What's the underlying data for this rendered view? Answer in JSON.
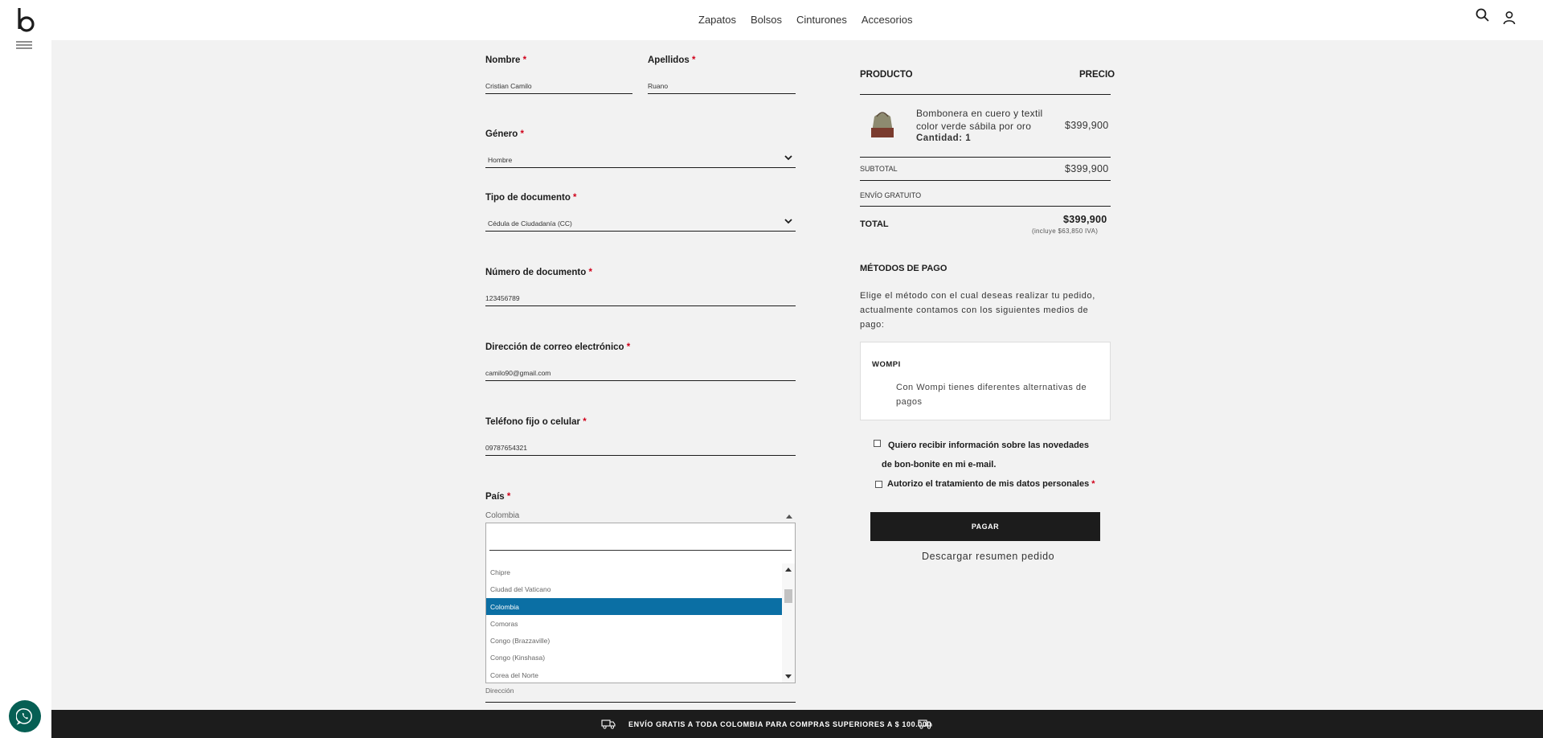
{
  "header": {
    "nav": [
      "Zapatos",
      "Bolsos",
      "Cinturones",
      "Accesorios"
    ]
  },
  "form": {
    "nombre": {
      "label": "Nombre",
      "value": "Cristian Camilo"
    },
    "apellidos": {
      "label": "Apellidos",
      "value": "Ruano"
    },
    "genero": {
      "label": "Género",
      "value": "Hombre"
    },
    "tipo_documento": {
      "label": "Tipo de documento",
      "value": "Cédula de Ciudadanía (CC)"
    },
    "numero_documento": {
      "label": "Número de documento",
      "value": "123456789"
    },
    "email": {
      "label": "Dirección de correo electrónico",
      "value": "camilo90@gmail.com"
    },
    "telefono": {
      "label": "Teléfono fijo o celular",
      "value": "09787654321"
    },
    "pais": {
      "label": "País",
      "value": "Colombia",
      "options": [
        "Chipre",
        "Ciudad del Vaticano",
        "Colombia",
        "Comoras",
        "Congo (Brazzaville)",
        "Congo (Kinshasa)",
        "Corea del Norte"
      ],
      "selected_index": 2
    },
    "direccion": {
      "placeholder": "Dirección"
    },
    "required_mark": "*"
  },
  "summary": {
    "col_product": "PRODUCTO",
    "col_price": "PRECIO",
    "item": {
      "name": "Bombonera en cuero y textil color verde sábila por oro",
      "qty_label": "Cantidad: 1",
      "price": "$399,900"
    },
    "subtotal_label": "SUBTOTAL",
    "subtotal_value": "$399,900",
    "shipping_label": "ENVÍO GRATUITO",
    "total_label": "TOTAL",
    "total_value": "$399,900",
    "tax_note": "(incluye $63,850 IVA)"
  },
  "payment": {
    "title": "MÉTODOS DE PAGO",
    "description": "Elige el método con el cual deseas realizar tu pedido, actualmente contamos con los siguientes medios de pago:",
    "method_name": "WOMPI",
    "method_desc": "Con Wompi tienes diferentes alternativas de pagos",
    "newsletter_label": "Quiero recibir información sobre las novedades de bon-bonite en mi e-mail.",
    "privacy_label": "Autorizo el tratamiento de mis datos personales",
    "pay_button": "PAGAR",
    "download_link": "Descargar resumen pedido"
  },
  "banner": {
    "text": "ENVÍO GRATIS A TODA COLOMBIA PARA COMPRAS SUPERIORES A $ 100.000"
  },
  "colors": {
    "accent": "#0b6fa4",
    "dark": "#1c1c1c",
    "required": "#d0021b",
    "whatsapp": "#065f54"
  },
  "icons": [
    "logo-icon",
    "hamburger-icon",
    "search-icon",
    "user-icon",
    "chevron-down-icon",
    "chevron-up-icon",
    "truck-icon",
    "whatsapp-icon"
  ]
}
